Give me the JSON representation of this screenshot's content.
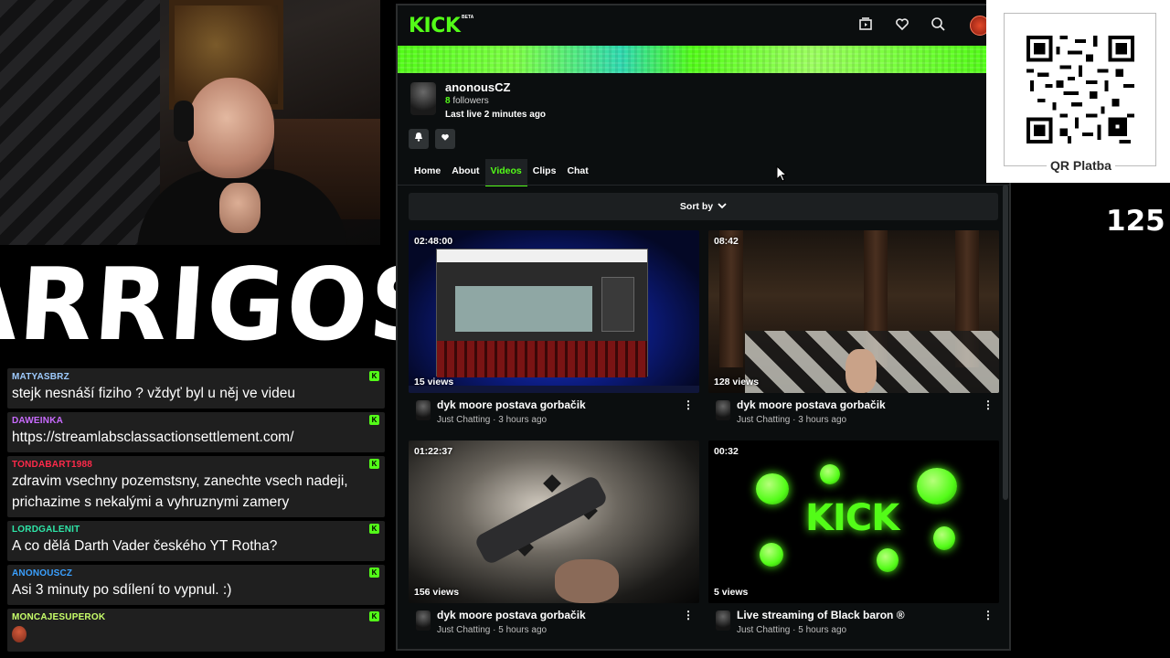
{
  "overlay": {
    "brand": "ARRIGOS",
    "counter": "125",
    "qr_label": "QR Platba"
  },
  "chat": [
    {
      "user": "MATYASBRZ",
      "color": "#9ecbff",
      "text": "stejk nesnáší fiziho ? vždyť byl u něj ve videu",
      "badge": true
    },
    {
      "user": "DAWEINKA",
      "color": "#c96bff",
      "text": "https://streamlabsclassactionsettlement.com/",
      "badge": true
    },
    {
      "user": "TONDABART1988",
      "color": "#ff2a4a",
      "text": "zdravim vsechny pozemstsny, zanechte vsech nadeji, prichazime s nekalými a vyhruznymi zamery",
      "badge": true
    },
    {
      "user": "LORDGALENIT",
      "color": "#2ee6a8",
      "text": "A co dělá Darth Vader českého YT Rotha?",
      "badge": true
    },
    {
      "user": "ANONOUSCZ",
      "color": "#3aa0ff",
      "text": "Asi 3 minuty po sdílení to vypnul. :)",
      "badge": true
    },
    {
      "user": "MONCAJESUPEROK",
      "color": "#c8ff6a",
      "text": "",
      "badge": true
    }
  ],
  "kick": {
    "logo": "KICK",
    "beta": "BETA",
    "header_icons": [
      "library-icon",
      "heart-icon",
      "search-icon",
      "user-avatar"
    ],
    "accent": "#53fc18",
    "channel": {
      "name": "anonousCZ",
      "followers_count": "8",
      "followers_label": "followers",
      "last_live": "Last live 2 minutes ago"
    },
    "tabs": [
      {
        "label": "Home",
        "active": false
      },
      {
        "label": "About",
        "active": false
      },
      {
        "label": "Videos",
        "active": true
      },
      {
        "label": "Clips",
        "active": false
      },
      {
        "label": "Chat",
        "active": false
      }
    ],
    "sort_label": "Sort by",
    "videos": [
      {
        "duration": "02:48:00",
        "views": "15 views",
        "title": "dyk moore postava gorbačik",
        "meta": "Just Chatting · 3 hours ago"
      },
      {
        "duration": "08:42",
        "views": "128 views",
        "title": "dyk moore postava gorbačik",
        "meta": "Just Chatting · 3 hours ago"
      },
      {
        "duration": "01:22:37",
        "views": "156 views",
        "title": "dyk moore postava gorbačik",
        "meta": "Just Chatting · 5 hours ago"
      },
      {
        "duration": "00:32",
        "views": "5 views",
        "title": "Live streaming of Black baron ®",
        "meta": "Just Chatting · 5 hours ago"
      }
    ]
  }
}
